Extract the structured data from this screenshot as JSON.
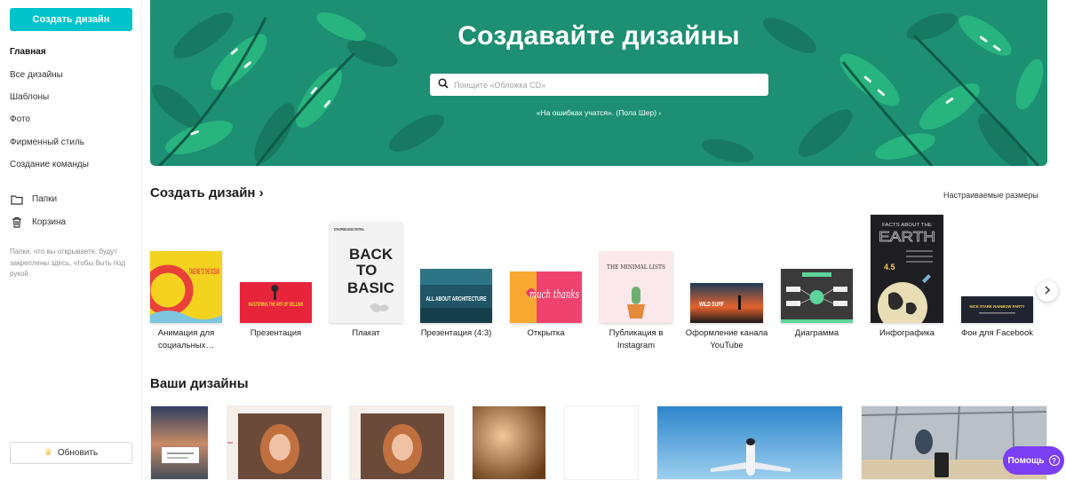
{
  "sidebar": {
    "create_label": "Создать дизайн",
    "items": [
      {
        "label": "Главная"
      },
      {
        "label": "Все дизайны"
      },
      {
        "label": "Шаблоны"
      },
      {
        "label": "Фото"
      },
      {
        "label": "Фирменный стиль"
      },
      {
        "label": "Создание команды"
      }
    ],
    "folders_label": "Папки",
    "trash_label": "Корзина",
    "pinned_note": "Папки, что вы открываете, будут закреплены здесь, чтобы быть под рукой.",
    "upgrade_label": "Обновить"
  },
  "hero": {
    "title": "Создавайте дизайны",
    "search_placeholder": "Поищите «Обложка CD»",
    "quote": "«На ошибках учатся». (Пола Шер) ›",
    "bg_color": "#1d8f72"
  },
  "create": {
    "title": "Создать дизайн ›",
    "custom_size": "Настраиваемые размеры",
    "templates": [
      {
        "label": "Анимация для социальных…",
        "thumb_text": "TAKE ME TO THE OCEAN"
      },
      {
        "label": "Презентация",
        "thumb_text": "MASTERING THE ART OF SELLING"
      },
      {
        "label": "Плакат",
        "thumb_text": "BACK TO BASIC",
        "thumb_sub": "20TH SPRING MUSIC FESTIVAL"
      },
      {
        "label": "Презентация (4:3)",
        "thumb_text": "ALL ABOUT ARCHITECTURE"
      },
      {
        "label": "Открытка",
        "thumb_text": "much thanks"
      },
      {
        "label": "Публикация в Instagram",
        "thumb_text": "THE MINIMAL LISTS"
      },
      {
        "label": "Оформление канала YouTube",
        "thumb_text": "WILD SURF"
      },
      {
        "label": "Диаграмма",
        "thumb_text": ""
      },
      {
        "label": "Инфографика",
        "thumb_text": "EARTH",
        "thumb_sub": "FACTS ABOUT THE",
        "thumb_num": "4.5"
      },
      {
        "label": "Фон для Facebook",
        "thumb_text": "NICK STARK RAINBOW PARTY"
      }
    ]
  },
  "designs": {
    "title": "Ваши дизайны"
  },
  "help": {
    "label": "Помощь"
  },
  "colors": {
    "accent": "#00c4cc",
    "help": "#7a3ff2"
  }
}
